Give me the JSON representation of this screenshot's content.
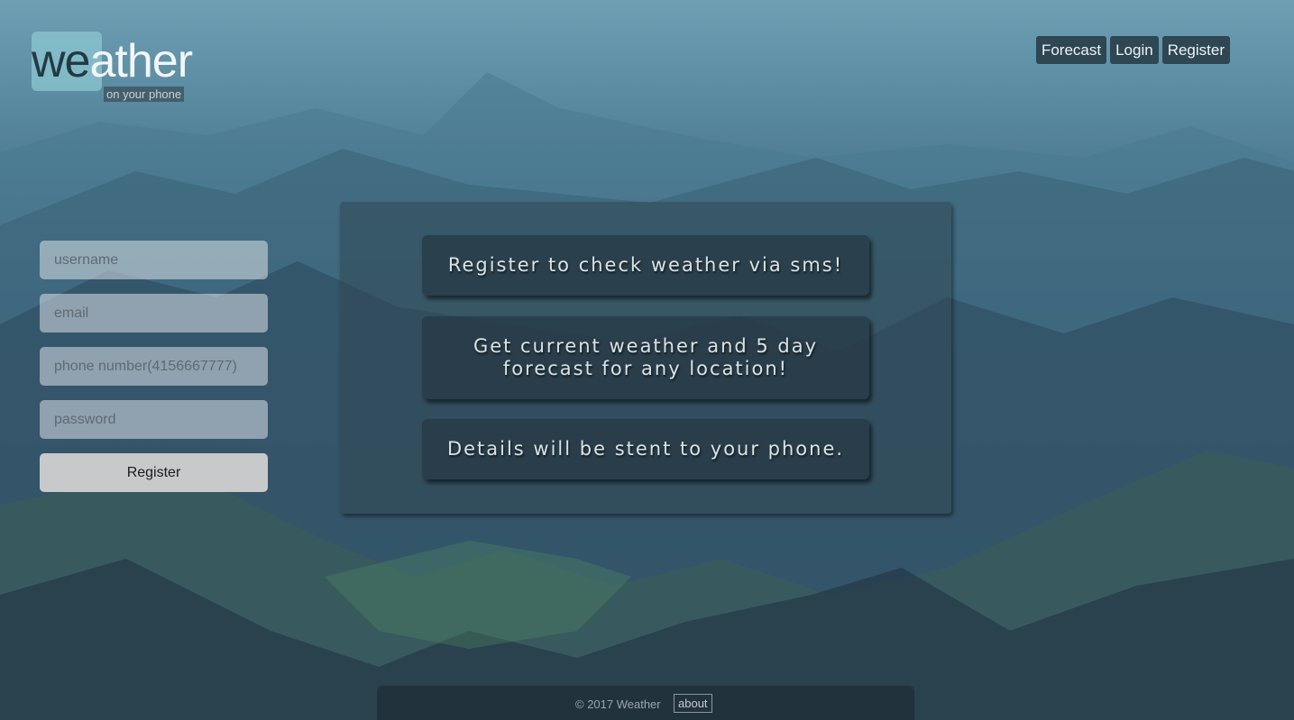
{
  "logo": {
    "part_dark": "we",
    "part_light": "ather",
    "tagline": "on your phone"
  },
  "nav": {
    "forecast": "Forecast",
    "login": "Login",
    "register": "Register"
  },
  "form": {
    "username_placeholder": "username",
    "email_placeholder": "email",
    "phone_placeholder": "phone number(4156667777)",
    "password_placeholder": "password",
    "submit_label": "Register"
  },
  "info": {
    "line1": "Register to check weather via sms!",
    "line2": "Get current weather and 5 day forecast for any location!",
    "line3": "Details will be stent to your phone."
  },
  "footer": {
    "copyright": "© 2017 Weather",
    "about": "about"
  }
}
